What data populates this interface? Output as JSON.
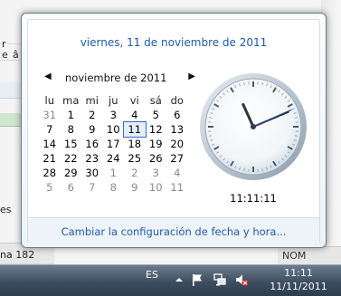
{
  "background": {
    "left_fragments": [
      "r",
      "e",
      "â",
      "es"
    ],
    "bottom_left": "na 182",
    "bottom_right": "NOM"
  },
  "calendar_flyout": {
    "date_header": "viernes, 11 de noviembre de 2011",
    "month_title": "noviembre de 2011",
    "prev_arrow": "◀",
    "next_arrow": "▶",
    "weekdays": [
      "lu",
      "ma",
      "mi",
      "ju",
      "vi",
      "sá",
      "do"
    ],
    "weeks": [
      [
        "31",
        "1",
        "2",
        "3",
        "4",
        "5",
        "6"
      ],
      [
        "7",
        "8",
        "9",
        "10",
        "11",
        "12",
        "13"
      ],
      [
        "14",
        "15",
        "16",
        "17",
        "18",
        "19",
        "20"
      ],
      [
        "21",
        "22",
        "23",
        "24",
        "25",
        "26",
        "27"
      ],
      [
        "28",
        "29",
        "30",
        "1",
        "2",
        "3",
        "4"
      ],
      [
        "5",
        "6",
        "7",
        "8",
        "9",
        "10",
        "11"
      ]
    ],
    "selected_day": "11",
    "clock_time": "11:11:11",
    "clock_hands": {
      "hour": 11,
      "minute": 11,
      "second": 11
    },
    "settings_link": "Cambiar la configuración de fecha y hora..."
  },
  "taskbar": {
    "language": "ES",
    "tray_icons": [
      "show-hidden-icons-arrow",
      "action-center-flag-icon",
      "network-icon",
      "volume-muted-icon"
    ],
    "time": "11:11",
    "date": "11/11/2011"
  },
  "colors": {
    "link": "#1e5aa8",
    "today_outline": "#2f6bc9",
    "taskbar": "#3d4e60"
  }
}
